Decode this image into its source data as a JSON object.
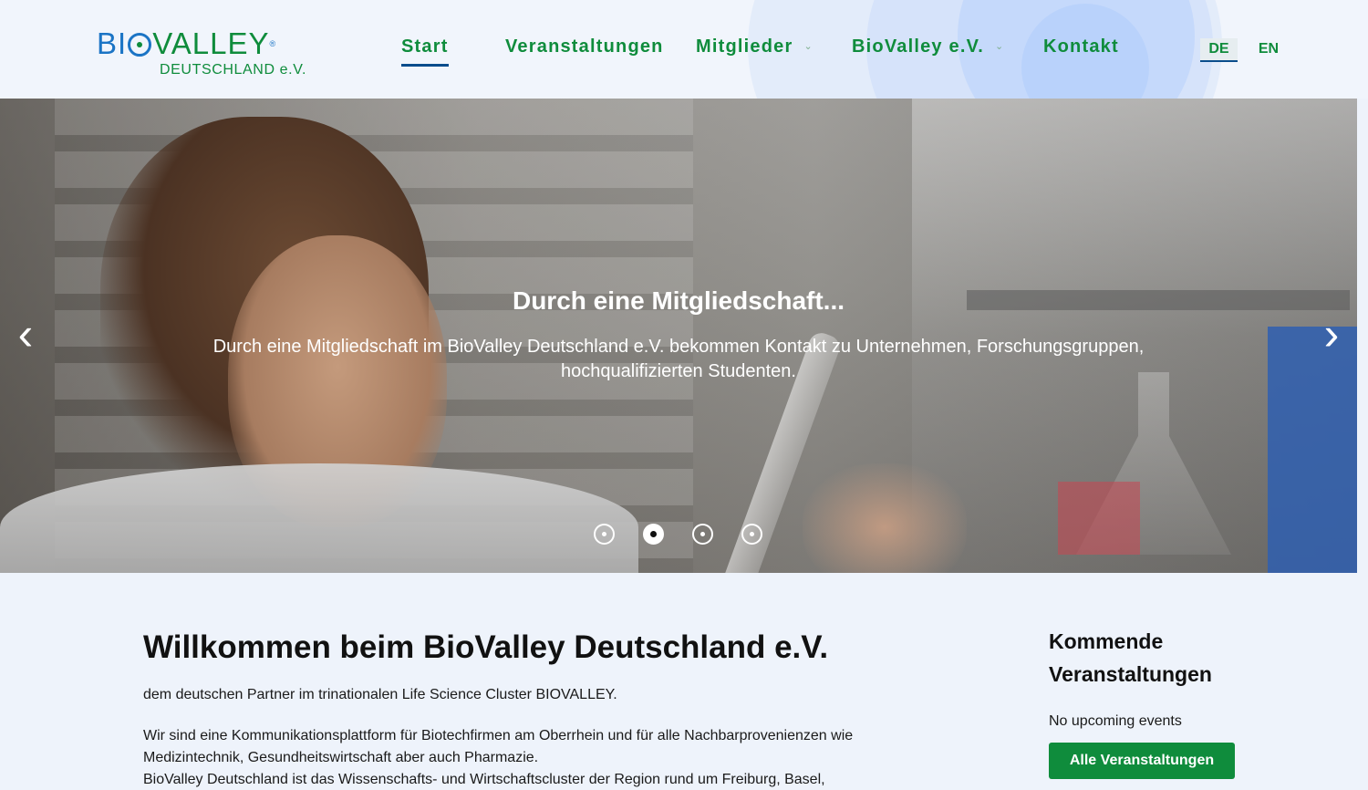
{
  "header": {
    "logo": {
      "top": "BIOVALLEY",
      "bottom": "DEUTSCHLAND e.V."
    },
    "nav": [
      {
        "label": "Start",
        "active": true
      },
      {
        "label": "Veranstaltungen"
      },
      {
        "label": "Mitglieder",
        "dropdown": true
      },
      {
        "label": "BioValley e.V.",
        "dropdown": true
      },
      {
        "label": "Kontakt"
      }
    ],
    "languages": [
      {
        "label": "DE",
        "active": true
      },
      {
        "label": "EN"
      }
    ]
  },
  "hero": {
    "title": "Durch eine Mitgliedschaft...",
    "text": "Durch eine Mitgliedschaft im BioValley Deutschland e.V. bekommen Kontakt zu Unternehmen, Forschungsgruppen, hochqualifizierten Studenten.",
    "slides_total": 4,
    "active_slide": 2,
    "prev_icon": "chevron-left-icon",
    "next_icon": "chevron-right-icon"
  },
  "main": {
    "title": "Willkommen beim BioValley Deutschland e.V.",
    "paragraph1": "dem deutschen Partner im trinationalen Life Science Cluster BIOVALLEY.",
    "paragraph2_line1": "Wir sind eine Kommunikationsplattform für Biotechfirmen am Oberrhein und für alle Nachbarprovenienzen wie",
    "paragraph2_line2": "Medizintechnik, Gesundheitswirtschaft aber auch Pharmazie.",
    "paragraph2_line3": "BioValley Deutschland  ist das Wissenschafts- und Wirtschaftscluster der Region rund um Freiburg, Basel,"
  },
  "sidebar": {
    "title": "Kommende Veranstaltungen",
    "empty_text": "No upcoming events",
    "button_label": "Alle Veranstaltungen"
  },
  "colors": {
    "brand_green": "#0f8c3c",
    "brand_blue": "#1b74c5",
    "active_underline": "#0a4d8c"
  }
}
